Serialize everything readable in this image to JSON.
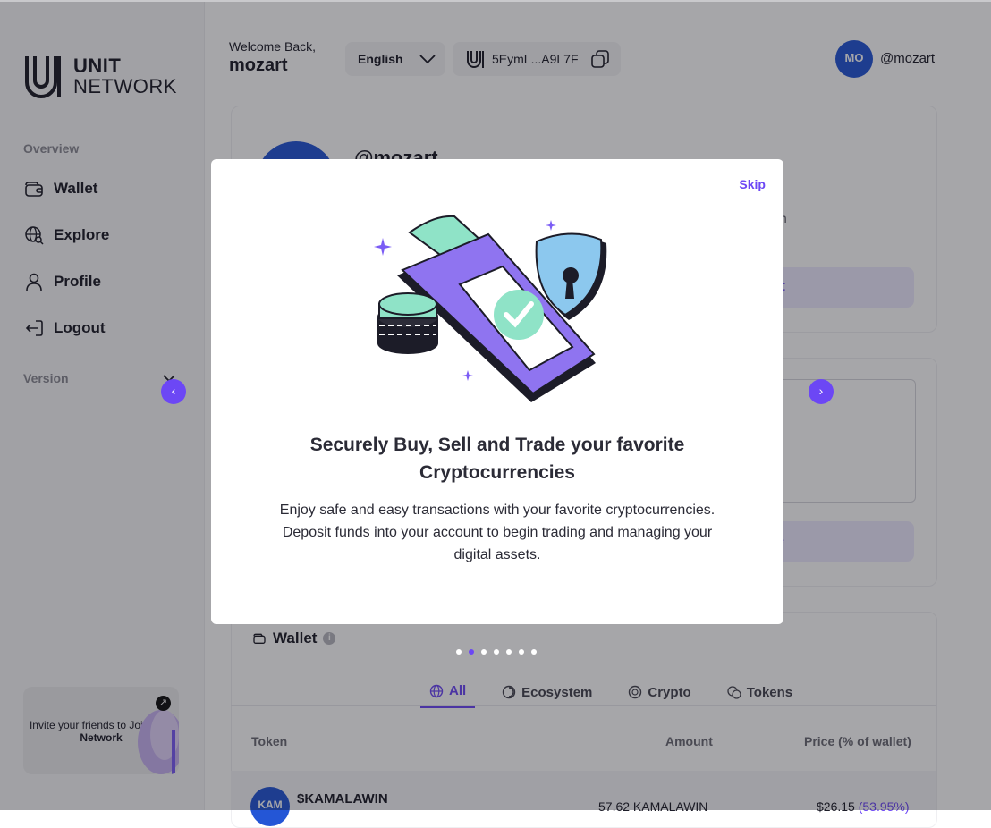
{
  "brand": {
    "line1": "UNIT",
    "line2": "NETWORK"
  },
  "sidebar": {
    "overview_label": "Overview",
    "items": [
      {
        "label": "Wallet",
        "icon": "wallet-icon"
      },
      {
        "label": "Explore",
        "icon": "globe-search-icon"
      },
      {
        "label": "Profile",
        "icon": "user-icon"
      },
      {
        "label": "Logout",
        "icon": "logout-icon"
      }
    ],
    "version_label": "Version",
    "invite": {
      "text": "Invite your friends to Join",
      "brand": "Unit Network"
    }
  },
  "header": {
    "welcome": "Welcome Back,",
    "username": "mozart",
    "language": "English",
    "address": "5EymL...A9L7F",
    "avatar_initials": "MO",
    "user_handle": "@mozart"
  },
  "profile": {
    "handle": "@mozart",
    "meta_fragment": "m",
    "edit_fragment": "it",
    "share_fragment": "e"
  },
  "wallet": {
    "title": "Wallet",
    "tabs": [
      "All",
      "Ecosystem",
      "Crypto",
      "Tokens"
    ],
    "active_tab": "All",
    "columns": {
      "token": "Token",
      "amount": "Amount",
      "price": "Price (% of wallet)"
    },
    "rows": [
      {
        "avatar": "KAM",
        "name": "$KAMALAWIN",
        "amount": "57.62 KAMALAWIN",
        "price": "$26.15",
        "percent": "(53.95%)"
      }
    ]
  },
  "modal": {
    "skip": "Skip",
    "title": "Securely Buy, Sell and Trade your favorite Cryptocurrencies",
    "body": "Enjoy safe and easy transactions with your favorite cryptocurrencies. Deposit funds into your account to begin trading and managing your digital assets.",
    "slide_count": 7,
    "active_slide": 2
  },
  "colors": {
    "accent": "#6c47f5",
    "avatar_blue": "#2456d6",
    "mint": "#8fe3c7",
    "shield_blue": "#8cc8ee"
  }
}
